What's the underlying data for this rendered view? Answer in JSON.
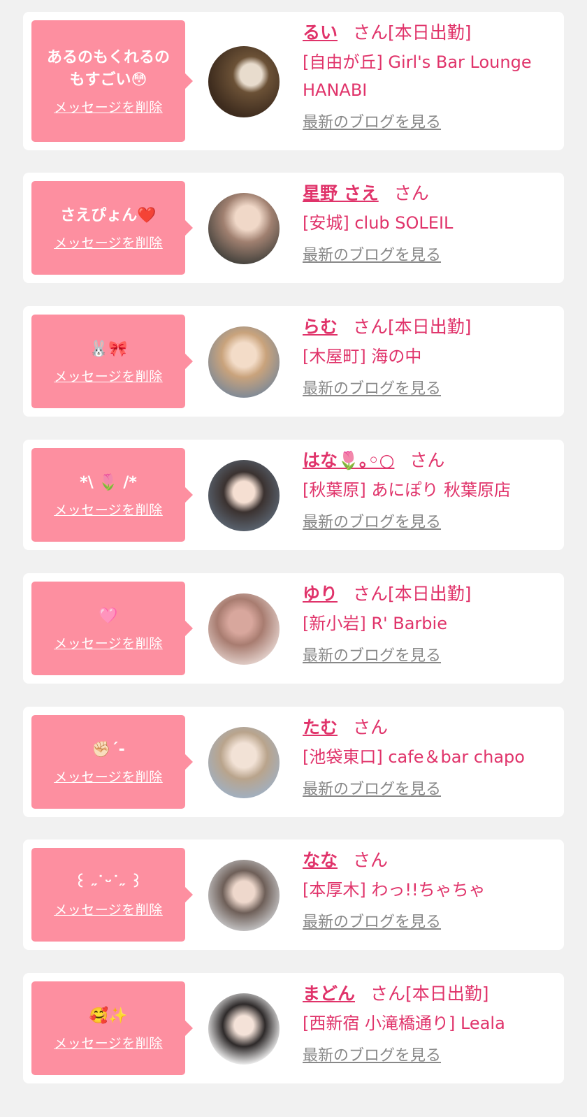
{
  "delete_label": "メッセージを削除",
  "honorific": "さん",
  "blog_label": "最新のブログを見る",
  "colors": {
    "accent": "#e0336a",
    "bubble": "#fd8fa0",
    "background": "#f1f1f1"
  },
  "entries": [
    {
      "message": "あるのもくれるの\nもすごい😳",
      "name": "るい",
      "status": "[本日出勤]",
      "shop": "[自由が丘] Girl's Bar Lounge HANABI"
    },
    {
      "message": "さえぴょん❤️",
      "name": "星野 さえ",
      "status": "",
      "shop": "[安城] club SOLEIL"
    },
    {
      "message": "🐰🎀",
      "name": "らむ",
      "status": "[本日出勤]",
      "shop": "[木屋町] 海の中"
    },
    {
      "message": "*\\ 🌷 /*",
      "name": "はな🌷｡◦○",
      "status": "",
      "shop": "[秋葉原] あにぽり 秋葉原店"
    },
    {
      "message": "🩷",
      "name": "ゆり",
      "status": "[本日出勤]",
      "shop": "[新小岩] R' Barbie"
    },
    {
      "message": "✊🏻´-",
      "name": "たむ",
      "status": "",
      "shop": "[池袋東口] cafe＆bar chapo"
    },
    {
      "message": "꒰ ˶˙ᵕ˙˶ ꒱",
      "name": "なな",
      "status": "",
      "shop": "[本厚木] わっ!!ちゃちゃ"
    },
    {
      "message": "🥰✨",
      "name": "まどん",
      "status": "[本日出勤]",
      "shop": "[西新宿 小滝橋通り] Leala"
    }
  ]
}
